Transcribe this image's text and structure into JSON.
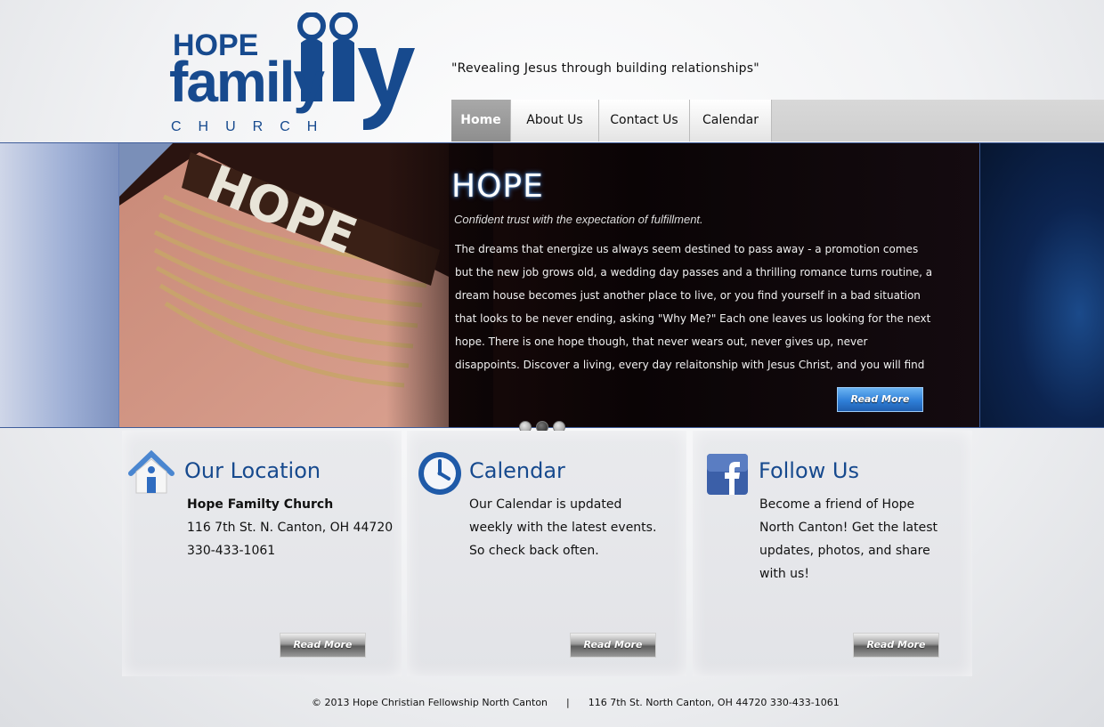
{
  "brand": {
    "logo_word_hope": "HOPE",
    "logo_word_family": "family",
    "logo_word_church": "CHURCH",
    "primary_color": "#174a8e"
  },
  "tagline": "\"Revealing Jesus through building relationships\"",
  "nav": {
    "items": [
      {
        "label": "Home",
        "active": true
      },
      {
        "label": "About Us",
        "active": false
      },
      {
        "label": "Contact Us",
        "active": false
      },
      {
        "label": "Calendar",
        "active": false
      }
    ]
  },
  "slider": {
    "title": "HOPE",
    "subtitle": "Confident trust with the expectation of fulfillment.",
    "body": "The dreams that energize us always seem destined to pass away - a promotion comes but the new job grows old, a wedding day passes and a thrilling romance turns routine, a dream house becomes just another place to live, or you find yourself in a bad situation that looks to be never ending, asking \"Why Me?\"  Each one leaves us looking for the next hope. There is one hope though, that never wears out, never gives up, never disappoints. Discover a living, every day relaitonship with Jesus Christ, and you will find hope that",
    "read_more": "Read More",
    "bracelet_text": "HOPE",
    "dots": [
      false,
      true,
      false
    ]
  },
  "location": {
    "icon": "house-icon",
    "title": "Our Location",
    "name": "Hope Familty Church",
    "address": "116 7th St. N. Canton, OH 44720",
    "phone": "330-433-1061",
    "read_more": "Read More"
  },
  "calendar": {
    "icon": "clock-icon",
    "title": "Calendar",
    "text": "Our Calendar is updated weekly with the latest events. So check back often.",
    "read_more": "Read More"
  },
  "follow": {
    "icon": "facebook-icon",
    "title": "Follow Us",
    "text": "Become a friend of Hope North Canton! Get the latest updates, photos, and share with us!",
    "read_more": "Read More"
  },
  "footer": {
    "copyright": "© 2013 Hope Christian Fellowship North Canton",
    "separator": "|",
    "address": "116 7th St. North Canton, OH 44720 330-433-1061"
  }
}
